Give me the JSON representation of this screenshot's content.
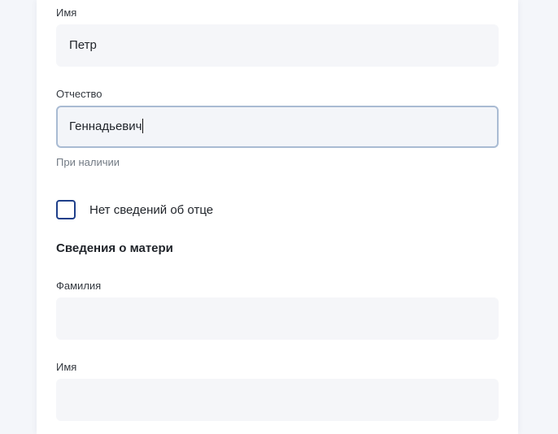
{
  "father": {
    "first_name": {
      "label": "Имя",
      "value": "Петр"
    },
    "patronymic": {
      "label": "Отчество",
      "value": "Геннадьевич",
      "hint": "При наличии"
    },
    "no_info_checkbox": {
      "label": "Нет сведений об отце",
      "checked": false
    }
  },
  "mother": {
    "section_title": "Сведения о матери",
    "last_name": {
      "label": "Фамилия",
      "value": ""
    },
    "first_name": {
      "label": "Имя",
      "value": ""
    }
  },
  "colors": {
    "page_background": "#f4f6fa",
    "field_background": "#f5f6f9",
    "focus_border": "#a9bbd3",
    "checkbox_border": "#1e3f8a"
  }
}
